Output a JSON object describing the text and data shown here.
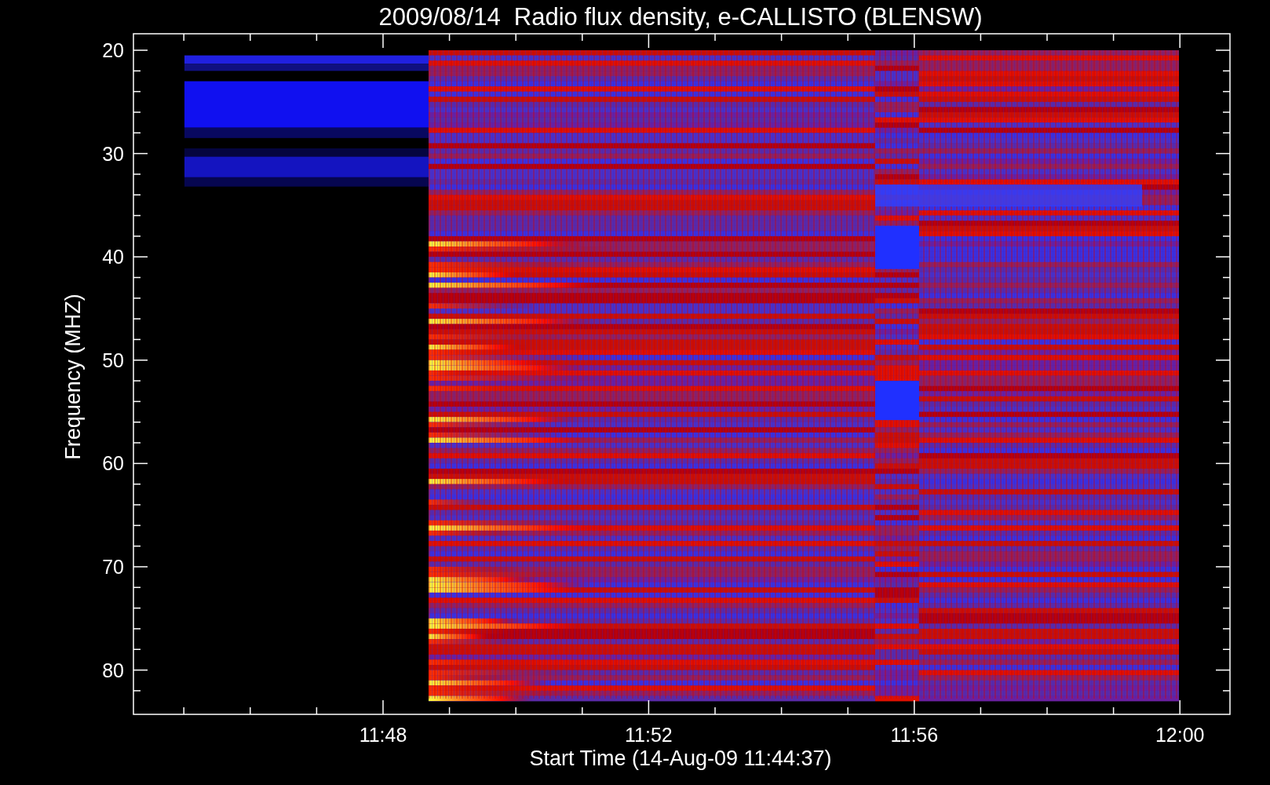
{
  "title": "2009/08/14  Radio flux density, e-CALLISTO (BLENSW)",
  "y_axis": {
    "label": "Frequency (MHZ)",
    "ticks": [
      "20",
      "30",
      "40",
      "50",
      "60",
      "70",
      "80"
    ]
  },
  "x_axis": {
    "label": "Start Time (14-Aug-09 11:44:37)",
    "ticks": [
      "11:48",
      "11:52",
      "11:56",
      "12:00"
    ]
  }
}
